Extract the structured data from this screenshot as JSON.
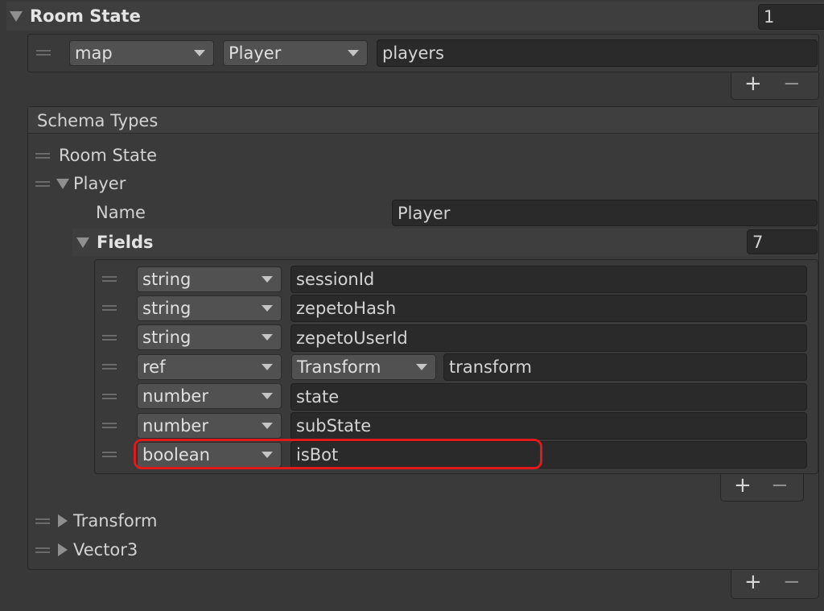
{
  "room_state": {
    "title": "Room State",
    "count": "1",
    "entry": {
      "type": "map",
      "class": "Player",
      "name": "players"
    }
  },
  "list_buttons": {
    "plus": "+",
    "minus": "−"
  },
  "schema": {
    "title": "Schema Types",
    "items": {
      "room_state": "Room State",
      "player": "Player",
      "transform": "Transform",
      "vector3": "Vector3"
    },
    "player": {
      "name_label": "Name",
      "name_value": "Player",
      "fields_label": "Fields",
      "fields_count": "7",
      "fields": [
        {
          "type": "string",
          "name": "sessionId"
        },
        {
          "type": "string",
          "name": "zepetoHash"
        },
        {
          "type": "string",
          "name": "zepetoUserId"
        },
        {
          "type": "ref",
          "ref_type": "Transform",
          "name": "transform"
        },
        {
          "type": "number",
          "name": "state"
        },
        {
          "type": "number",
          "name": "subState"
        },
        {
          "type": "boolean",
          "name": "isBot"
        }
      ]
    }
  },
  "colors": {
    "highlight": "#e0191b",
    "background": "#383838"
  }
}
